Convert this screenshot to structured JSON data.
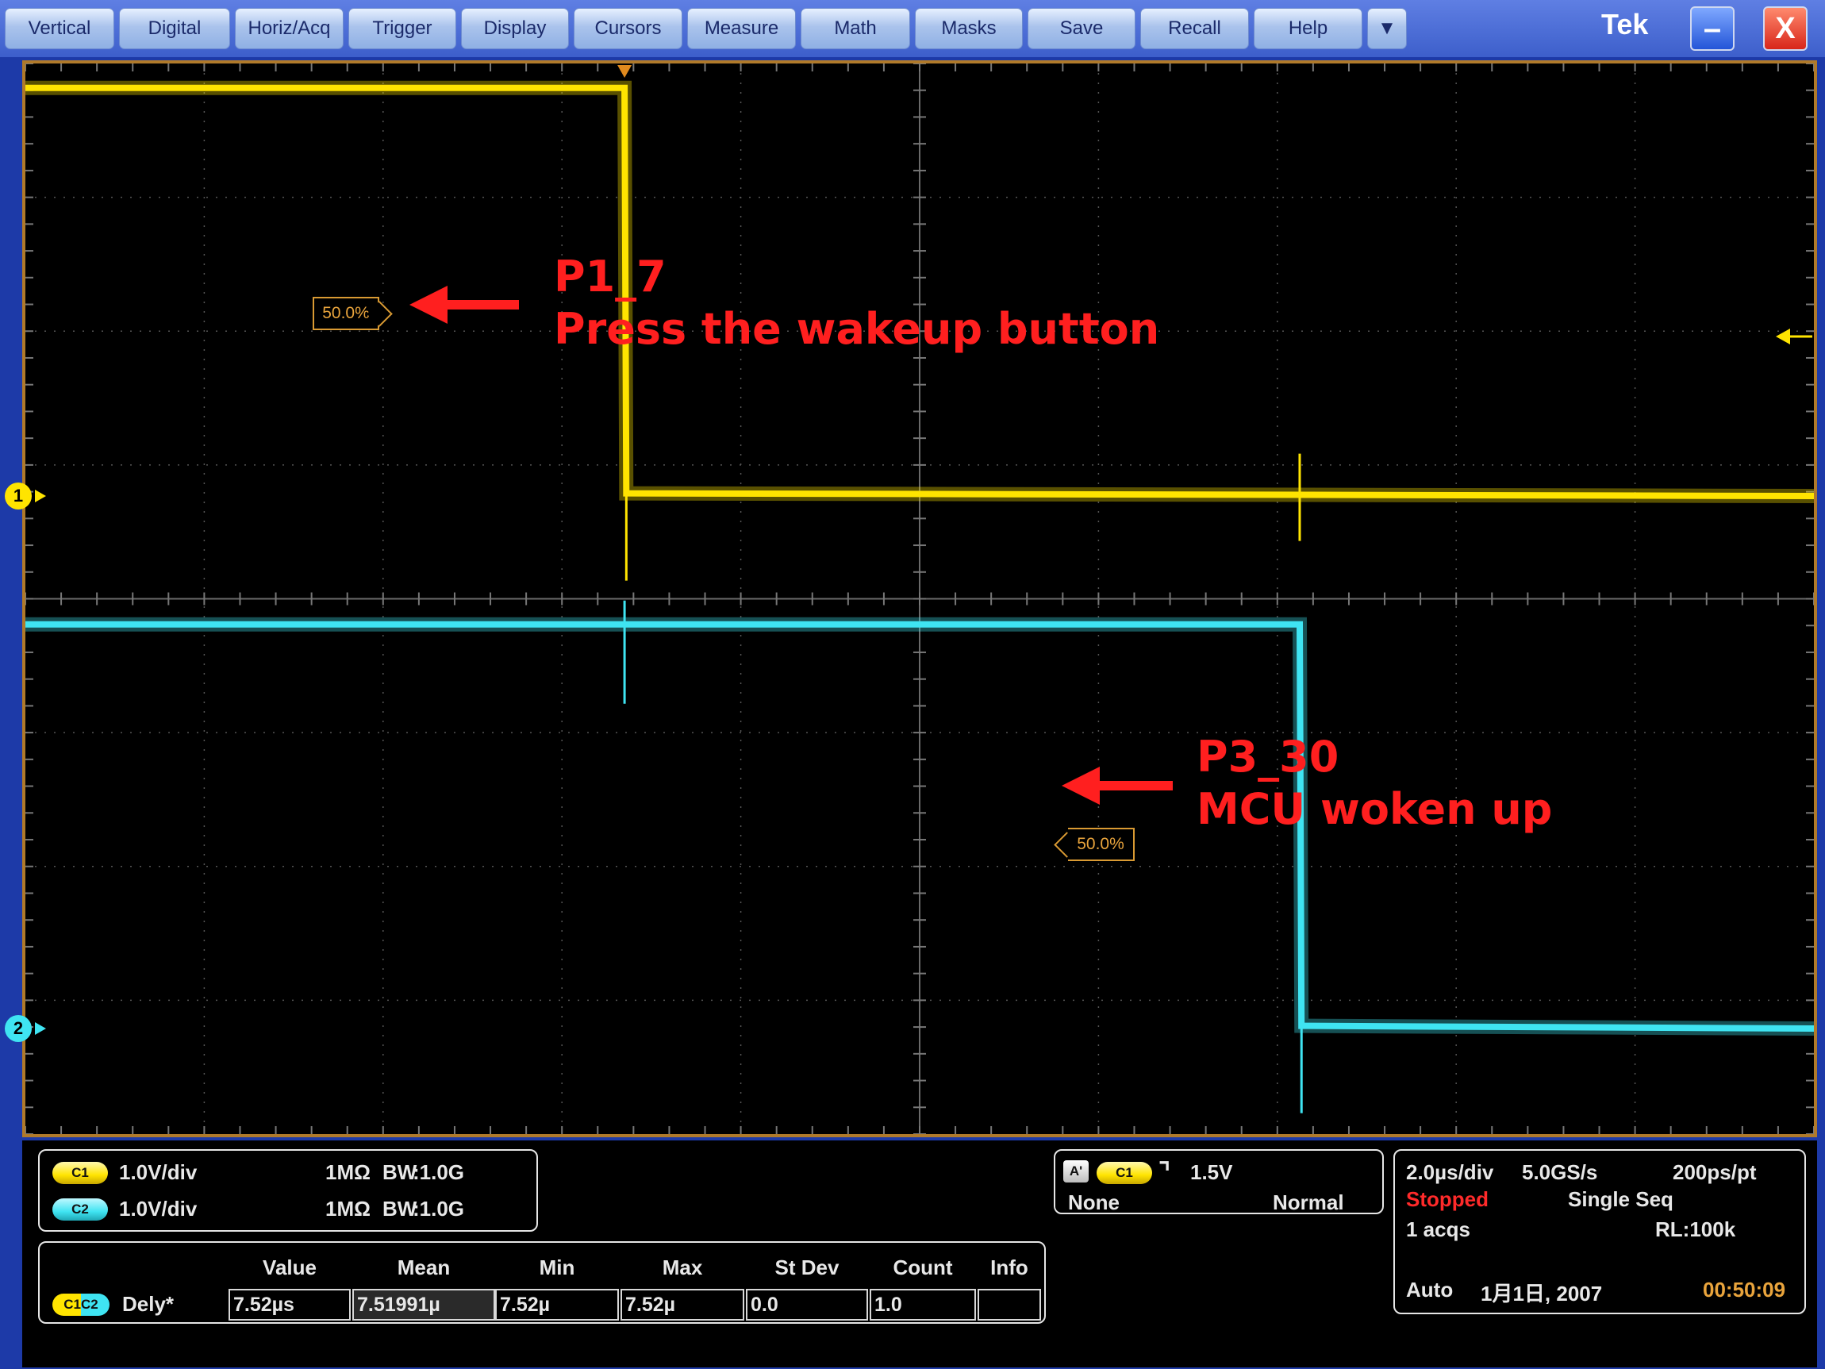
{
  "menu": {
    "items": [
      "Vertical",
      "Digital",
      "Horiz/Acq",
      "Trigger",
      "Display",
      "Cursors",
      "Measure",
      "Math",
      "Masks",
      "Save",
      "Recall",
      "Help"
    ],
    "overflow_icon": "caret-down-icon"
  },
  "window": {
    "brand": "Tek",
    "minimize_icon": "minimize-icon",
    "minimize_glyph": "–",
    "close_icon": "close-icon",
    "close_glyph": "X"
  },
  "annotations": {
    "ch1_title": "P1_7",
    "ch1_desc": "Press the wakeup button",
    "ch2_title": "P3_30",
    "ch2_desc": "MCU woken up"
  },
  "trigger_levels": {
    "ch1": "50.0%",
    "ch2": "50.0%"
  },
  "channel_markers": {
    "ch1": "1",
    "ch2": "2"
  },
  "colors": {
    "ch1": "#ffe400",
    "ch2": "#3fe4f2",
    "annotation": "#ff1f1f",
    "trigger": "#d99a33",
    "stopped": "#ff2a2a",
    "clock": "#e9a43c"
  },
  "channels": [
    {
      "label": "C1",
      "scale": "1.0V/div",
      "impedance": "1MΩ",
      "bandwidth_label": "BW",
      "bandwidth": ":1.0G"
    },
    {
      "label": "C2",
      "scale": "1.0V/div",
      "impedance": "1MΩ",
      "bandwidth_label": "BW",
      "bandwidth": ":1.0G"
    }
  ],
  "trigger": {
    "mode_badge": "A'",
    "source": "C1",
    "slope_icon": "falling-edge-icon",
    "slope_glyph": "⌝",
    "level": "1.5V",
    "coupling": "None",
    "type": "Normal"
  },
  "acquisition": {
    "time_div": "2.0µs/div",
    "sample_rate": "5.0GS/s",
    "resolution": "200ps/pt",
    "state": "Stopped",
    "mode": "Single Seq",
    "acqs": "1 acqs",
    "record_length": "RL:100k",
    "trigger_mode": "Auto",
    "date": "1月1日, 2007",
    "time": "00:50:09"
  },
  "measurement": {
    "source": "C1C2",
    "name": "Dely*",
    "headers": [
      "Value",
      "Mean",
      "Min",
      "Max",
      "St Dev",
      "Count",
      "Info"
    ],
    "values": [
      "7.52µs",
      "7.51991µ",
      "7.52µ",
      "7.52µ",
      "0.0",
      "1.0",
      ""
    ]
  },
  "chart_data": {
    "type": "line",
    "title": "",
    "xlabel": "",
    "ylabel": "",
    "x_unit": "µs",
    "grid": true,
    "xlim": [
      0,
      20
    ],
    "series": [
      {
        "name": "P1_7",
        "x": [
          0,
          6.7,
          6.72,
          20
        ],
        "y": [
          3.05,
          3.05,
          0.02,
          0.0
        ]
      },
      {
        "name": "P3_30",
        "x": [
          0,
          14.25,
          14.27,
          20
        ],
        "y": [
          3.02,
          3.02,
          0.02,
          0.0
        ]
      }
    ]
  }
}
